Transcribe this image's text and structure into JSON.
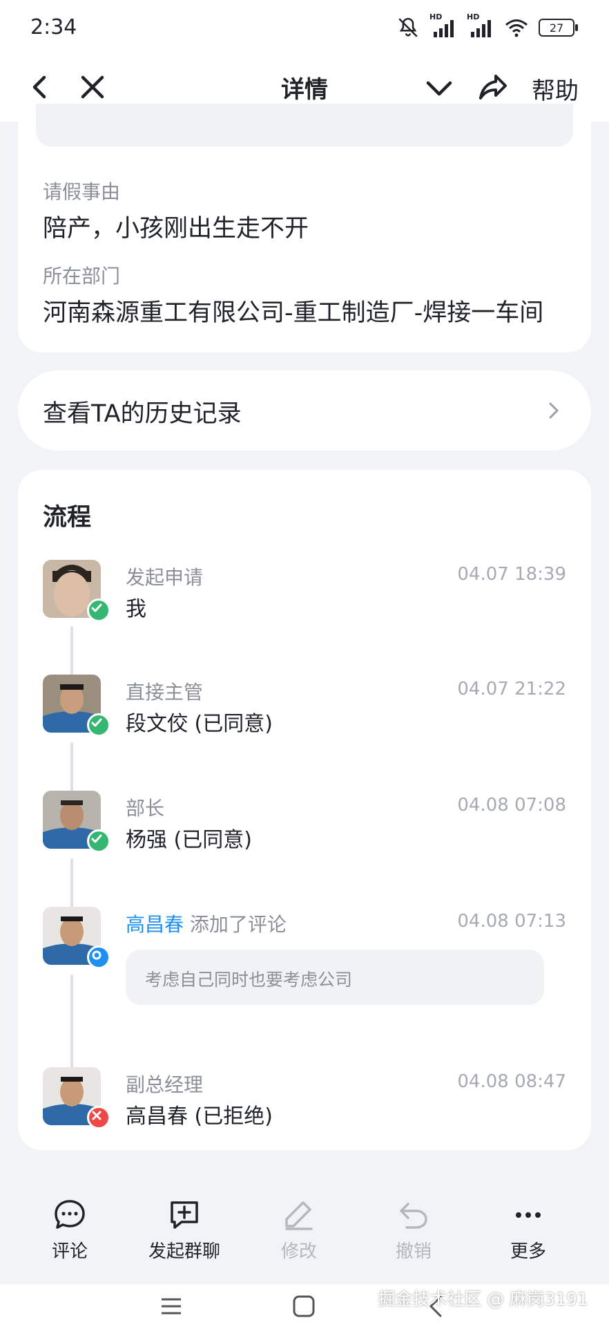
{
  "status_bar": {
    "time": "2:34",
    "battery": "27",
    "hd_label": "HD"
  },
  "nav": {
    "title": "详情",
    "help_label": "帮助"
  },
  "details": {
    "reason_label": "请假事由",
    "reason_value": "陪产，小孩刚出生走不开",
    "department_label": "所在部门",
    "department_value": "河南森源重工有限公司-重工制造厂-焊接一车间"
  },
  "history": {
    "label": "查看TA的历史记录"
  },
  "flow": {
    "title": "流程",
    "steps": [
      {
        "role": "发起申请",
        "name": "我",
        "time": "04.07 18:39",
        "status": "approved"
      },
      {
        "role": "直接主管",
        "name": "段文佼 (已同意)",
        "time": "04.07 21:22",
        "status": "approved"
      },
      {
        "role": "部长",
        "name": "杨强 (已同意)",
        "time": "04.08 07:08",
        "status": "approved"
      },
      {
        "commenter": "高昌春",
        "action": "添加了评论",
        "comment": "考虑自己同时也要考虑公司",
        "time": "04.08 07:13",
        "status": "comment"
      },
      {
        "role": "副总经理",
        "name": "高昌春 (已拒绝)",
        "time": "04.08 08:47",
        "status": "rejected"
      }
    ]
  },
  "toolbar": {
    "comment_label": "评论",
    "group_chat_label": "发起群聊",
    "edit_label": "修改",
    "revoke_label": "撤销",
    "more_label": "更多"
  },
  "watermark": "掘金技术社区 @ 麻岗3191",
  "colors": {
    "accent": "#1f8ff0",
    "approved": "#35b772",
    "rejected": "#f04848",
    "page_bg": "#f2f3f6"
  }
}
